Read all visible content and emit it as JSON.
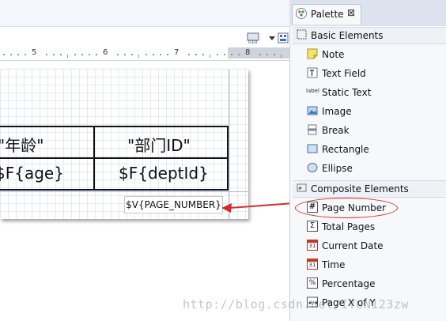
{
  "editor": {
    "ruler_numbers": [
      "5",
      "6",
      "7",
      "8"
    ]
  },
  "report": {
    "headers": [
      "\"年龄\"",
      "\"部门ID\""
    ],
    "fields": [
      "$F{age}",
      "$F{deptId}"
    ],
    "page_number_field": "$V{PAGE_NUMBER}"
  },
  "palette": {
    "tab_title": "Palette",
    "tab_close": "⊠",
    "groups": [
      {
        "label": "Basic Elements",
        "items": [
          {
            "label": "Note",
            "icon": "note-icon"
          },
          {
            "label": "Text Field",
            "icon": "text-field-icon"
          },
          {
            "label": "Static Text",
            "icon": "static-text-icon"
          },
          {
            "label": "Image",
            "icon": "image-icon"
          },
          {
            "label": "Break",
            "icon": "break-icon"
          },
          {
            "label": "Rectangle",
            "icon": "rectangle-icon"
          },
          {
            "label": "Ellipse",
            "icon": "ellipse-icon"
          }
        ]
      },
      {
        "label": "Composite Elements",
        "items": [
          {
            "label": "Page Number",
            "icon": "page-number-icon"
          },
          {
            "label": "Total Pages",
            "icon": "sigma-icon"
          },
          {
            "label": "Current Date",
            "icon": "calendar-icon"
          },
          {
            "label": "Time",
            "icon": "calendar-icon"
          },
          {
            "label": "Percentage",
            "icon": "percent-icon"
          },
          {
            "label": "Page X of Y",
            "icon": "page-x-of-y-icon"
          }
        ]
      }
    ],
    "static_text_icon_text": "label",
    "page_number_icon_text": "#",
    "sigma_icon_text": "Σ",
    "percent_icon_text": "%",
    "calendar_icon_text": "31"
  },
  "watermark": "http://blog.csdn.net/IYUN123zw",
  "colors": {
    "annotation": "#d62b2b"
  }
}
